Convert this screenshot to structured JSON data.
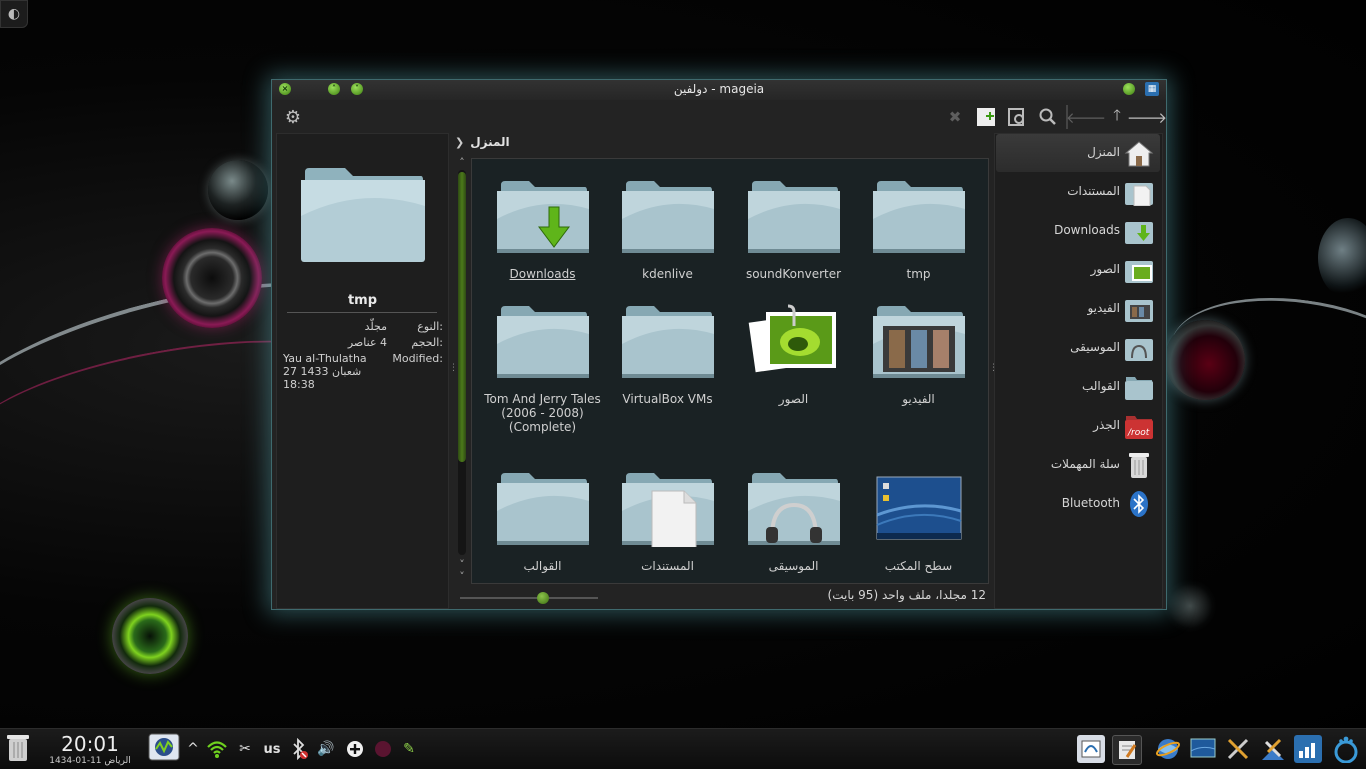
{
  "window": {
    "title": "mageia - دولفين",
    "buttons": {
      "close": "×",
      "minimize": "˄",
      "maximize": "˅"
    }
  },
  "toolbar": {
    "settings_icon": "gear-icon",
    "actions": [
      "delete-icon",
      "new-folder-icon",
      "preview-icon",
      "search-icon",
      "back-icon",
      "up-icon",
      "forward-icon"
    ]
  },
  "info_panel": {
    "name": "tmp",
    "rows": [
      {
        "key": "النوع:",
        "value": "مجلّد"
      },
      {
        "key": "الحجم:",
        "value": "4 عناصر"
      }
    ],
    "modified_key": "Modified:",
    "modified_value": [
      "Yau al-Thulatha",
      "27 1433 شعبان",
      "18:38"
    ]
  },
  "breadcrumb": {
    "label": "المنزل"
  },
  "items": [
    {
      "label": "Downloads",
      "icon": "downloads-folder",
      "underline": true
    },
    {
      "label": "kdenlive",
      "icon": "folder"
    },
    {
      "label": "soundKonverter",
      "icon": "folder"
    },
    {
      "label": "tmp",
      "icon": "folder"
    },
    {
      "label": "Tom And Jerry Tales (2006 - 2008) (Complete)",
      "icon": "folder"
    },
    {
      "label": "VirtualBox VMs",
      "icon": "folder"
    },
    {
      "label": "الصور",
      "icon": "pictures"
    },
    {
      "label": "الفيديو",
      "icon": "videos"
    },
    {
      "label": "القوالب",
      "icon": "folder"
    },
    {
      "label": "المستندات",
      "icon": "documents"
    },
    {
      "label": "الموسيقى",
      "icon": "music"
    },
    {
      "label": "سطح المكتب",
      "icon": "desktop"
    }
  ],
  "status_text": "12 مجلدا، ملف واحد (95 بايت)",
  "zoom_level": 0.6,
  "places": [
    {
      "label": "المنزل",
      "icon": "home",
      "selected": true
    },
    {
      "label": "المستندات",
      "icon": "documents"
    },
    {
      "label": "Downloads",
      "icon": "downloads"
    },
    {
      "label": "الصور",
      "icon": "pictures"
    },
    {
      "label": "الفيديو",
      "icon": "videos"
    },
    {
      "label": "الموسيقى",
      "icon": "music"
    },
    {
      "label": "القوالب",
      "icon": "folder"
    },
    {
      "label": "الجذر",
      "icon": "root"
    },
    {
      "label": "سلة المهملات",
      "icon": "trash"
    },
    {
      "label": "Bluetooth",
      "icon": "bluetooth"
    }
  ],
  "root_badge": "/root",
  "taskbar": {
    "clock": "20:01",
    "date": "1434-01-11 الرياض",
    "keyboard_layout": "us",
    "tray_icons": [
      "network-monitor-icon",
      "expand-tray-icon",
      "wifi-icon",
      "scissors-icon",
      "keyboard-layout",
      "bluetooth-off-icon",
      "volume-icon",
      "add-icon",
      "record-icon",
      "color-picker-icon"
    ],
    "task_icons": [
      "dolphin-task-icon",
      "editor-task-icon",
      "browser-task-icon",
      "desktop-task-icon",
      "tools-task-icon",
      "system-settings-icon",
      "file-manager-icon",
      "mageia-menu-icon"
    ]
  },
  "colors": {
    "accent": "#7fd21f",
    "window_glow": "#5aaab4",
    "folder": "#a9c4cd"
  }
}
